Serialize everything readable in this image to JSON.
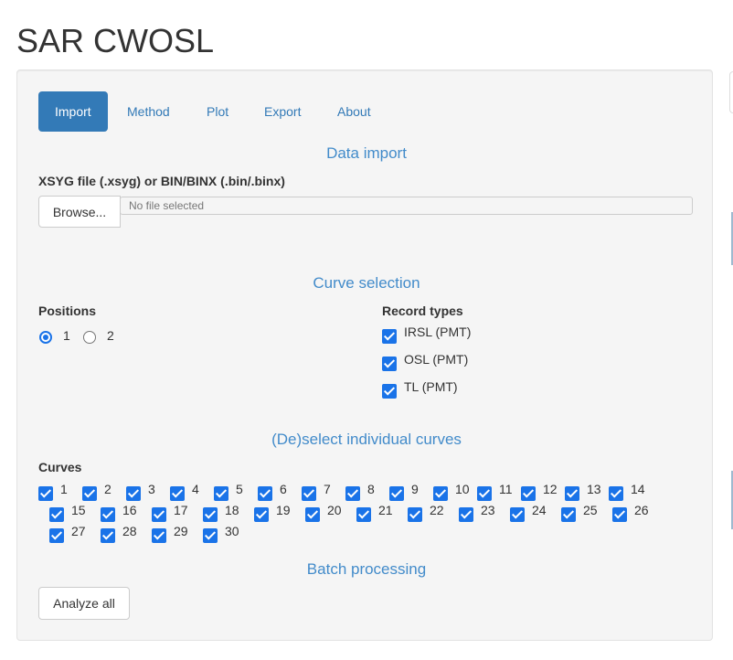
{
  "app": {
    "title": "SAR CWOSL"
  },
  "tabs": [
    {
      "label": "Import",
      "active": true
    },
    {
      "label": "Method",
      "active": false
    },
    {
      "label": "Plot",
      "active": false
    },
    {
      "label": "Export",
      "active": false
    },
    {
      "label": "About",
      "active": false
    }
  ],
  "data_import": {
    "heading": "Data import",
    "file_label": "XSYG file (.xsyg) or BIN/BINX (.bin/.binx)",
    "browse_label": "Browse...",
    "file_placeholder": "No file selected"
  },
  "curve_selection": {
    "heading": "Curve selection",
    "positions_label": "Positions",
    "positions": [
      {
        "label": "1",
        "selected": true
      },
      {
        "label": "2",
        "selected": false
      }
    ],
    "record_types_label": "Record types",
    "record_types": [
      {
        "label": "IRSL (PMT)",
        "checked": true
      },
      {
        "label": "OSL (PMT)",
        "checked": true
      },
      {
        "label": "TL (PMT)",
        "checked": true
      }
    ]
  },
  "individual_curves": {
    "heading": "(De)select individual curves",
    "curves_label": "Curves",
    "curves": [
      "1",
      "2",
      "3",
      "4",
      "5",
      "6",
      "7",
      "8",
      "9",
      "10",
      "11",
      "12",
      "13",
      "14",
      "15",
      "16",
      "17",
      "18",
      "19",
      "20",
      "21",
      "22",
      "23",
      "24",
      "25",
      "26",
      "27",
      "28",
      "29",
      "30"
    ]
  },
  "batch": {
    "heading": "Batch processing",
    "analyze_label": "Analyze all"
  },
  "colors": {
    "accent": "#337ab7",
    "heading": "#428bca",
    "checkbox": "#1a73e8",
    "well": "#f5f5f5"
  }
}
